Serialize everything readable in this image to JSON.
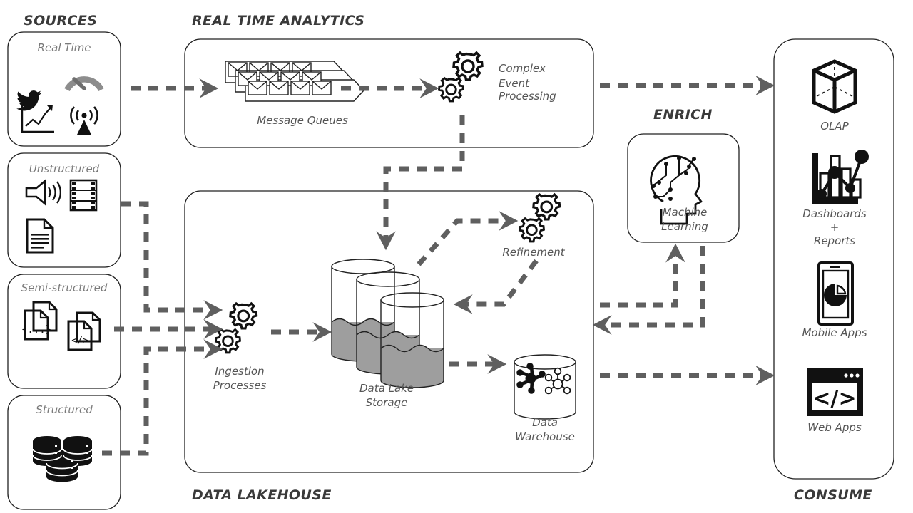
{
  "sections": {
    "sources": "SOURCES",
    "realtime": "REAL TIME ANALYTICS",
    "enrich": "ENRICH",
    "lakehouse": "DATA LAKEHOUSE",
    "consume": "CONSUME"
  },
  "sources": {
    "boxes": [
      {
        "label": "Real Time",
        "icons": [
          "twitter-bird-icon",
          "gauge-icon",
          "line-chart-icon",
          "signal-tower-icon"
        ]
      },
      {
        "label": "Unstructured",
        "icons": [
          "speaker-audio-icon",
          "film-strip-icon",
          "text-document-icon"
        ]
      },
      {
        "label": "Semi-structured",
        "icons": [
          "json-documents-icon",
          "xml-documents-icon"
        ]
      },
      {
        "label": "Structured",
        "icons": [
          "database-stack-icon"
        ]
      }
    ]
  },
  "realtime": {
    "message_queues": "Message Queues",
    "cep": "Complex\nEvent\nProcessing",
    "cep_lines": [
      "Complex",
      "Event",
      "Processing"
    ]
  },
  "lakehouse": {
    "ingestion_lines": [
      "Ingestion",
      "Processes"
    ],
    "lake_lines": [
      "Data Lake",
      "Storage"
    ],
    "refinement": "Refinement",
    "warehouse_lines": [
      "Data",
      "Warehouse"
    ]
  },
  "enrich": {
    "ml_lines": [
      "Machine",
      "Learning"
    ]
  },
  "consume": {
    "items": [
      {
        "label_lines": [
          "OLAP"
        ],
        "icon": "olap-cube-icon"
      },
      {
        "label_lines": [
          "Dashboards",
          "+",
          "Reports"
        ],
        "icon": "bar-line-chart-icon"
      },
      {
        "label_lines": [
          "Mobile Apps"
        ],
        "icon": "mobile-phone-pie-icon"
      },
      {
        "label_lines": [
          "Web Apps"
        ],
        "icon": "browser-code-icon"
      }
    ]
  },
  "colors": {
    "flow": "#5f5f5f",
    "panel_stroke": "#222222",
    "heading": "#3a3a3a",
    "box_label": "#7a7a7a",
    "node_label": "#555555",
    "water_fill": "#9e9e9e",
    "gauge": "#8d8d8d"
  }
}
